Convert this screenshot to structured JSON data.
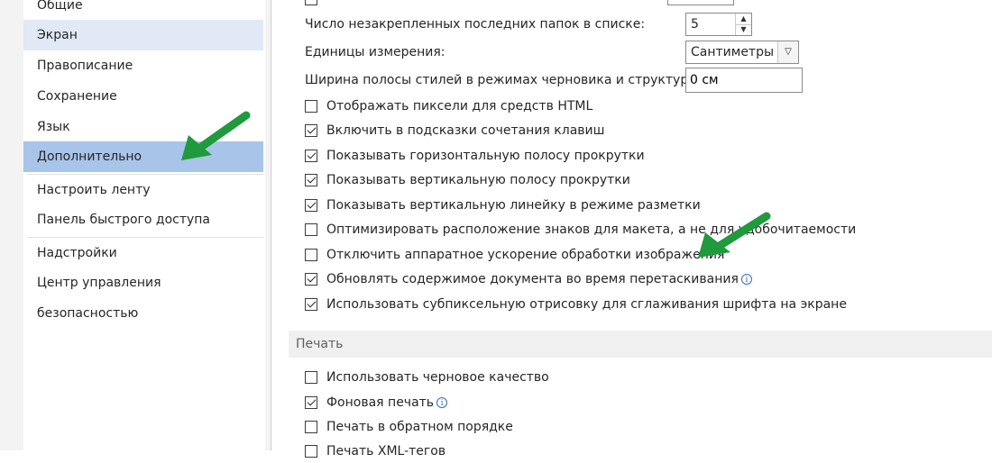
{
  "sidebar": {
    "items": [
      {
        "label": "Общие"
      },
      {
        "label": "Экран"
      },
      {
        "label": "Правописание"
      },
      {
        "label": "Сохранение"
      },
      {
        "label": "Язык"
      },
      {
        "label": "Дополнительно"
      },
      {
        "label": "Настроить ленту"
      },
      {
        "label": "Панель быстрого доступа"
      },
      {
        "label": "Надстройки"
      },
      {
        "label": "Центр управления безопасностью"
      }
    ]
  },
  "settings": {
    "recent_folders_label": "Число незакрепленных последних папок в списке:",
    "recent_folders_value": "5",
    "units_label": "Единицы измерения:",
    "units_value": "Сантиметры",
    "style_width_label": "Ширина полосы стилей в режимах черновика и структуры:",
    "style_width_value": "0 см",
    "checkboxes": [
      {
        "label": "Отображать пиксели для средств HTML",
        "checked": false
      },
      {
        "label": "Включить в подсказки сочетания клавиш",
        "checked": true
      },
      {
        "label": "Показывать горизонтальную полосу прокрутки",
        "checked": true
      },
      {
        "label": "Показывать вертикальную полосу прокрутки",
        "checked": true
      },
      {
        "label": "Показывать вертикальную линейку в режиме разметки",
        "checked": true
      },
      {
        "label": "Оптимизировать расположение знаков для макета, а не для удобочитаемости",
        "checked": false
      },
      {
        "label": "Отключить аппаратное ускорение обработки изображения",
        "checked": false
      },
      {
        "label": "Обновлять содержимое документа во время перетаскивания",
        "checked": true
      },
      {
        "label": "Использовать субпиксельную отрисовку для сглаживания шрифта на экране",
        "checked": true
      }
    ]
  },
  "print_section": {
    "title": "Печать",
    "checkboxes": [
      {
        "label": "Использовать черновое качество",
        "checked": false
      },
      {
        "label": "Фоновая печать",
        "checked": true
      },
      {
        "label": "Печать в обратном порядке",
        "checked": false
      },
      {
        "label": "Печать XML-тегов",
        "checked": false
      }
    ]
  },
  "colors": {
    "active_nav": "#a8c4e9",
    "light_nav": "#e1e9f6",
    "arrow": "#1f9a3c",
    "info": "#2f6fc0"
  },
  "icons": [
    "info-icon",
    "spin-up-icon",
    "spin-down-icon",
    "chevron-down-icon",
    "checkmark-icon",
    "green-arrow-annotation"
  ]
}
